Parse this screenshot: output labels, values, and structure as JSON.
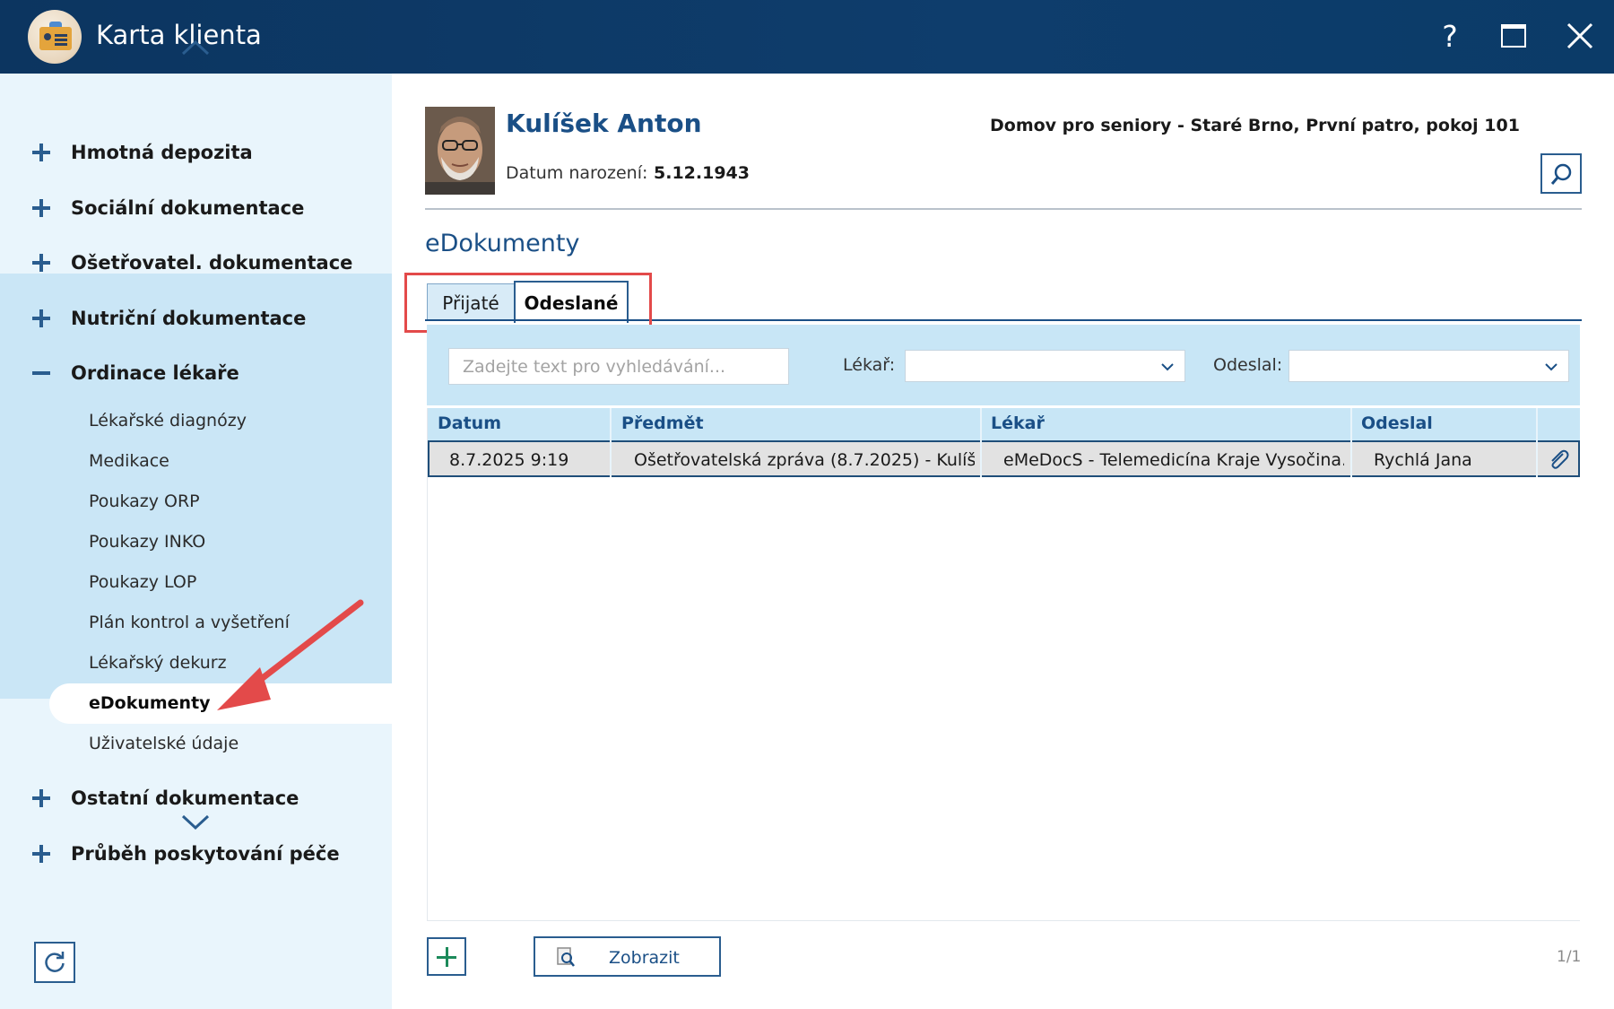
{
  "window": {
    "title": "Karta klienta",
    "help_label": "?"
  },
  "sidebar": {
    "sections": [
      {
        "label": "Hmotná depozita",
        "expanded": false
      },
      {
        "label": "Sociální dokumentace",
        "expanded": false
      },
      {
        "label": "Ošetřovatel. dokumentace",
        "expanded": false
      },
      {
        "label": "Nutriční dokumentace",
        "expanded": false
      },
      {
        "label": "Ordinace lékaře",
        "expanded": true
      },
      {
        "label": "Ostatní dokumentace",
        "expanded": false
      },
      {
        "label": "Průběh poskytování péče",
        "expanded": false
      }
    ],
    "subitems": [
      "Lékařské diagnózy",
      "Medikace",
      "Poukazy ORP",
      "Poukazy INKO",
      "Poukazy LOP",
      "Plán kontrol a vyšetření",
      "Lékařský dekurz",
      "eDokumenty",
      "Uživatelské údaje"
    ],
    "active_subitem": "eDokumenty"
  },
  "client": {
    "name": "Kulíšek Anton",
    "birth_label": "Datum narození:",
    "birth_date": "5.12.1943",
    "location": "Domov pro seniory - Staré Brno, První patro, pokoj 101"
  },
  "main": {
    "section_title": "eDokumenty",
    "tabs": [
      {
        "label": "Přijaté",
        "active": false
      },
      {
        "label": "Odeslané",
        "active": true
      }
    ],
    "search": {
      "placeholder": "Zadejte text pro vyhledávání...",
      "value": ""
    },
    "filters": {
      "doctor_label": "Lékař:",
      "doctor_value": "",
      "sender_label": "Odeslal:",
      "sender_value": ""
    },
    "table": {
      "columns": [
        "Datum",
        "Předmět",
        "Lékař",
        "Odeslal"
      ],
      "rows": [
        {
          "date": "8.7.2025 9:19",
          "subject": "Ošetřovatelská zpráva (8.7.2025) - Kulíš...",
          "doctor": "eMeDocS - Telemedicína Kraje Vysočina...",
          "sender": "Rychlá Jana",
          "has_attachment": true
        }
      ]
    },
    "show_button_label": "Zobrazit",
    "pager": "1/1"
  },
  "colors": {
    "titlebar": "#0e3d6c",
    "sidebar_bg": "#e9f5fc",
    "sidebar_open_bg": "#cae6f6",
    "accent": "#1a4f86",
    "annotation_red": "#e34a4a"
  }
}
